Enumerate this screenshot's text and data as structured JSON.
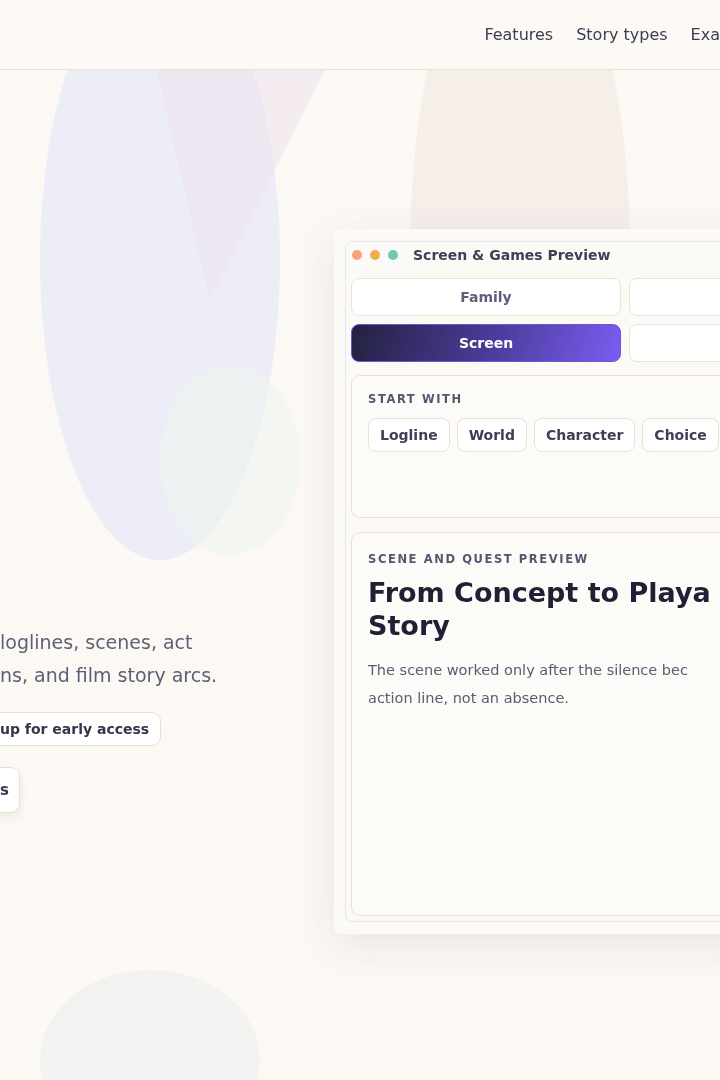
{
  "nav": {
    "links": [
      "Features",
      "Story types",
      "Exa"
    ]
  },
  "hero": {
    "description_lines": [
      "loglines, scenes, act",
      "ns, and film story arcs."
    ],
    "buttons": [
      {
        "label": "up for early access",
        "kind": "secondary"
      },
      {
        "label": "s",
        "kind": "raised"
      }
    ]
  },
  "preview": {
    "title": "Screen & Games Preview",
    "tabs": [
      {
        "label": "Family",
        "selected": false
      },
      {
        "selected": false
      },
      {
        "label": "Screen",
        "selected": true
      },
      {
        "selected": false
      }
    ],
    "start_with": {
      "label": "START WITH",
      "chips": [
        "Logline",
        "World",
        "Character",
        "Choice"
      ]
    },
    "scene": {
      "label": "SCENE AND QUEST PREVIEW",
      "title_lines": [
        "From Concept to Playa",
        "Story"
      ],
      "body_lines": [
        "The scene worked only after the silence bec",
        "action line, not an absence."
      ]
    }
  }
}
